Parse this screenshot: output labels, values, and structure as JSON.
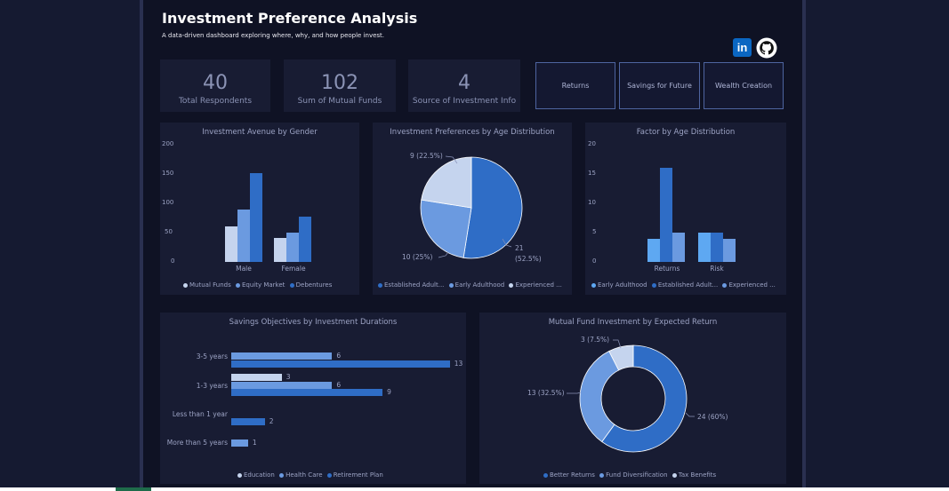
{
  "header": {
    "title": "Investment Preference Analysis",
    "subtitle": "A data-driven dashboard exploring where, why, and how people invest.",
    "linkedin_label": "in"
  },
  "colors": {
    "light": "#c5d4ee",
    "medium": "#6b9ae0",
    "dark": "#2f6dc6",
    "sky": "#5ea8f2",
    "background": "#0f1224",
    "panel": "#181c33"
  },
  "kpis": [
    {
      "value": "40",
      "label": "Total Respondents"
    },
    {
      "value": "102",
      "label": "Sum of Mutual Funds"
    },
    {
      "value": "4",
      "label": "Source of Investment Info"
    }
  ],
  "buttons": [
    {
      "label": "Returns"
    },
    {
      "label": "Savings for Future"
    },
    {
      "label": "Wealth Creation"
    }
  ],
  "chart_data": [
    {
      "type": "bar",
      "title": "Investment Avenue by Gender",
      "categories": [
        "Male",
        "Female"
      ],
      "ylim": [
        0,
        200
      ],
      "yticks": [
        "200",
        "150",
        "100",
        "50",
        "0"
      ],
      "series": [
        {
          "name": "Mutual Funds",
          "values": [
            61,
            41
          ]
        },
        {
          "name": "Equity Market",
          "values": [
            89,
            50
          ]
        },
        {
          "name": "Debentures",
          "values": [
            152,
            78
          ]
        }
      ],
      "legend": "bottom"
    },
    {
      "type": "pie",
      "title": "Investment Preferences by Age Distribution",
      "slices": [
        {
          "name": "Established Adult...",
          "value": 21,
          "label": "21 (52.5%)"
        },
        {
          "name": "Early Adulthood",
          "value": 10,
          "label": "10 (25%)"
        },
        {
          "name": "Experienced ...",
          "value": 9,
          "label": "9 (22.5%)"
        }
      ],
      "legend": "bottom"
    },
    {
      "type": "bar",
      "title": "Factor by Age Distribution",
      "categories": [
        "Returns",
        "Risk"
      ],
      "ylim": [
        0,
        20
      ],
      "yticks": [
        "20",
        "15",
        "10",
        "5",
        "0"
      ],
      "series": [
        {
          "name": "Early Adulthood",
          "values": [
            4,
            5
          ]
        },
        {
          "name": "Established Adult...",
          "values": [
            16,
            5
          ]
        },
        {
          "name": "Experienced ...",
          "values": [
            5,
            4
          ]
        }
      ],
      "legend": "bottom"
    },
    {
      "type": "bar",
      "orientation": "horizontal",
      "title": "Savings Objectives by Investment Durations",
      "categories": [
        "3-5 years",
        "1-3 years",
        "Less than 1 year",
        "More than 5 years"
      ],
      "series": [
        {
          "name": "Education",
          "values": [
            null,
            3,
            null,
            null
          ]
        },
        {
          "name": "Health Care",
          "values": [
            6,
            6,
            null,
            1
          ]
        },
        {
          "name": "Retirement Plan",
          "values": [
            13,
            9,
            2,
            null
          ]
        }
      ],
      "legend": "bottom"
    },
    {
      "type": "pie",
      "donut": true,
      "title": "Mutual Fund Investment by Expected Return",
      "slices": [
        {
          "name": "Better Returns",
          "value": 24,
          "label": "24 (60%)"
        },
        {
          "name": "Fund Diversification",
          "value": 13,
          "label": "13 (32.5%)"
        },
        {
          "name": "Tax Benefits",
          "value": 3,
          "label": "3 (7.5%)"
        }
      ],
      "legend": "bottom"
    }
  ]
}
